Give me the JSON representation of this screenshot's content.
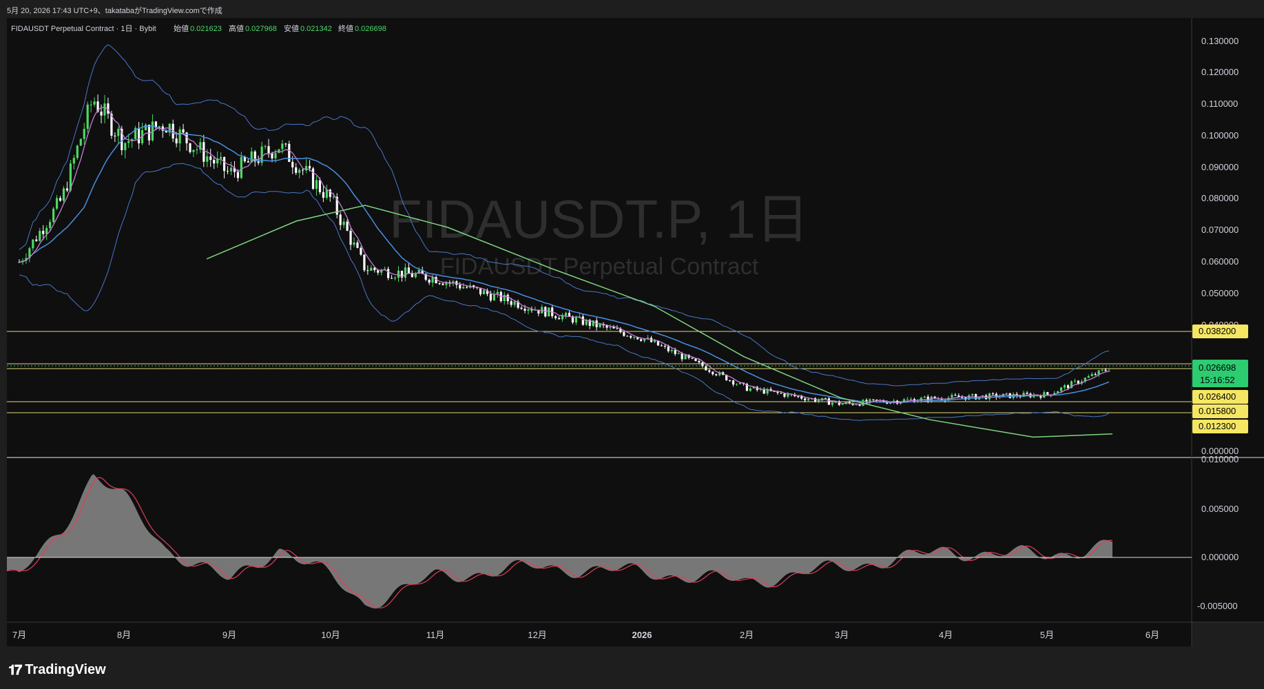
{
  "header": {
    "caption": "5月 20, 2026 17:43 UTC+9、takatabaがTradingView.comで作成"
  },
  "legend": {
    "symbol": "FIDAUSDT Perpetual Contract · 1日 · Bybit",
    "open_label": "始値",
    "open": "0.021623",
    "high_label": "高値",
    "high": "0.027968",
    "low_label": "安値",
    "low": "0.021342",
    "close_label": "終値",
    "close": "0.026698"
  },
  "watermark": {
    "main": "FIDAUSDT.P, 1日",
    "sub": "FIDAUSDT Perpetual Contract"
  },
  "footer": {
    "brand": "TradingView",
    "logo_glyph": "𝟏𝟕"
  },
  "colors": {
    "background": "#0f0f0f",
    "up": "#4cd964",
    "down": "#ffffff",
    "boll": "#4a78c9",
    "ma_fast": "#c87fd6",
    "ma_mid": "#4a90e2",
    "ma_slow": "#7fd67f",
    "hline": "#e6d97a",
    "price_tag": "#f5e663",
    "last_tag": "#2ecc71",
    "macd_line": "#e0405a",
    "hist": "#8a8a8a"
  },
  "chart_data": [
    {
      "type": "candlestick",
      "title": "FIDAUSDT Perpetual Contract · 1日 · Bybit",
      "x_ticks": [
        "7月",
        "8月",
        "9月",
        "10月",
        "11月",
        "12月",
        "2026",
        "2月",
        "3月",
        "4月",
        "5月",
        "6月"
      ],
      "y_ticks": [
        "0.130000",
        "0.120000",
        "0.110000",
        "0.100000",
        "0.090000",
        "0.080000",
        "0.070000",
        "0.060000",
        "0.050000",
        "0.040000",
        "0.000000"
      ],
      "ylim": [
        0,
        0.13
      ],
      "horizontal_levels": [
        "0.038200",
        "0.028100",
        "0.026400",
        "0.015800",
        "0.012300"
      ],
      "last_price": "0.026698",
      "countdown": "15:16:52",
      "approx_close_path": [
        {
          "x": "7月",
          "y": 0.06
        },
        {
          "x": "7月中旬",
          "y": 0.08
        },
        {
          "x": "7月下旬",
          "y": 0.112
        },
        {
          "x": "8月",
          "y": 0.098
        },
        {
          "x": "8月中旬",
          "y": 0.104
        },
        {
          "x": "9月",
          "y": 0.088
        },
        {
          "x": "9月中旬",
          "y": 0.097
        },
        {
          "x": "10月",
          "y": 0.08
        },
        {
          "x": "10月中旬",
          "y": 0.058
        },
        {
          "x": "11月",
          "y": 0.055
        },
        {
          "x": "12月",
          "y": 0.045
        },
        {
          "x": "2026",
          "y": 0.036
        },
        {
          "x": "1月下旬",
          "y": 0.027
        },
        {
          "x": "2月",
          "y": 0.02
        },
        {
          "x": "3月",
          "y": 0.015
        },
        {
          "x": "4月",
          "y": 0.017
        },
        {
          "x": "5月",
          "y": 0.018
        },
        {
          "x": "5月下旬",
          "y": 0.026698
        }
      ]
    },
    {
      "type": "area",
      "title": "MACD",
      "y_ticks": [
        "0.010000",
        "0.005000",
        "0.000000",
        "-0.005000"
      ],
      "ylim": [
        -0.0065,
        0.011
      ],
      "approx_hist": [
        {
          "x": "7月",
          "y": -0.002
        },
        {
          "x": "7月中旬",
          "y": 0.003
        },
        {
          "x": "7月下旬",
          "y": 0.0085
        },
        {
          "x": "8月",
          "y": 0.006
        },
        {
          "x": "8月中旬",
          "y": 0.001
        },
        {
          "x": "9月",
          "y": -0.0025
        },
        {
          "x": "9月中旬",
          "y": 0.001
        },
        {
          "x": "10月",
          "y": -0.002
        },
        {
          "x": "10月中旬",
          "y": -0.0048
        },
        {
          "x": "11月",
          "y": -0.002
        },
        {
          "x": "12月",
          "y": -0.001
        },
        {
          "x": "2026",
          "y": -0.0015
        },
        {
          "x": "2月",
          "y": -0.0025
        },
        {
          "x": "3月",
          "y": -0.001
        },
        {
          "x": "4月",
          "y": 0.0006
        },
        {
          "x": "5月",
          "y": 0.0002
        },
        {
          "x": "5月下旬",
          "y": 0.0013
        }
      ]
    }
  ]
}
